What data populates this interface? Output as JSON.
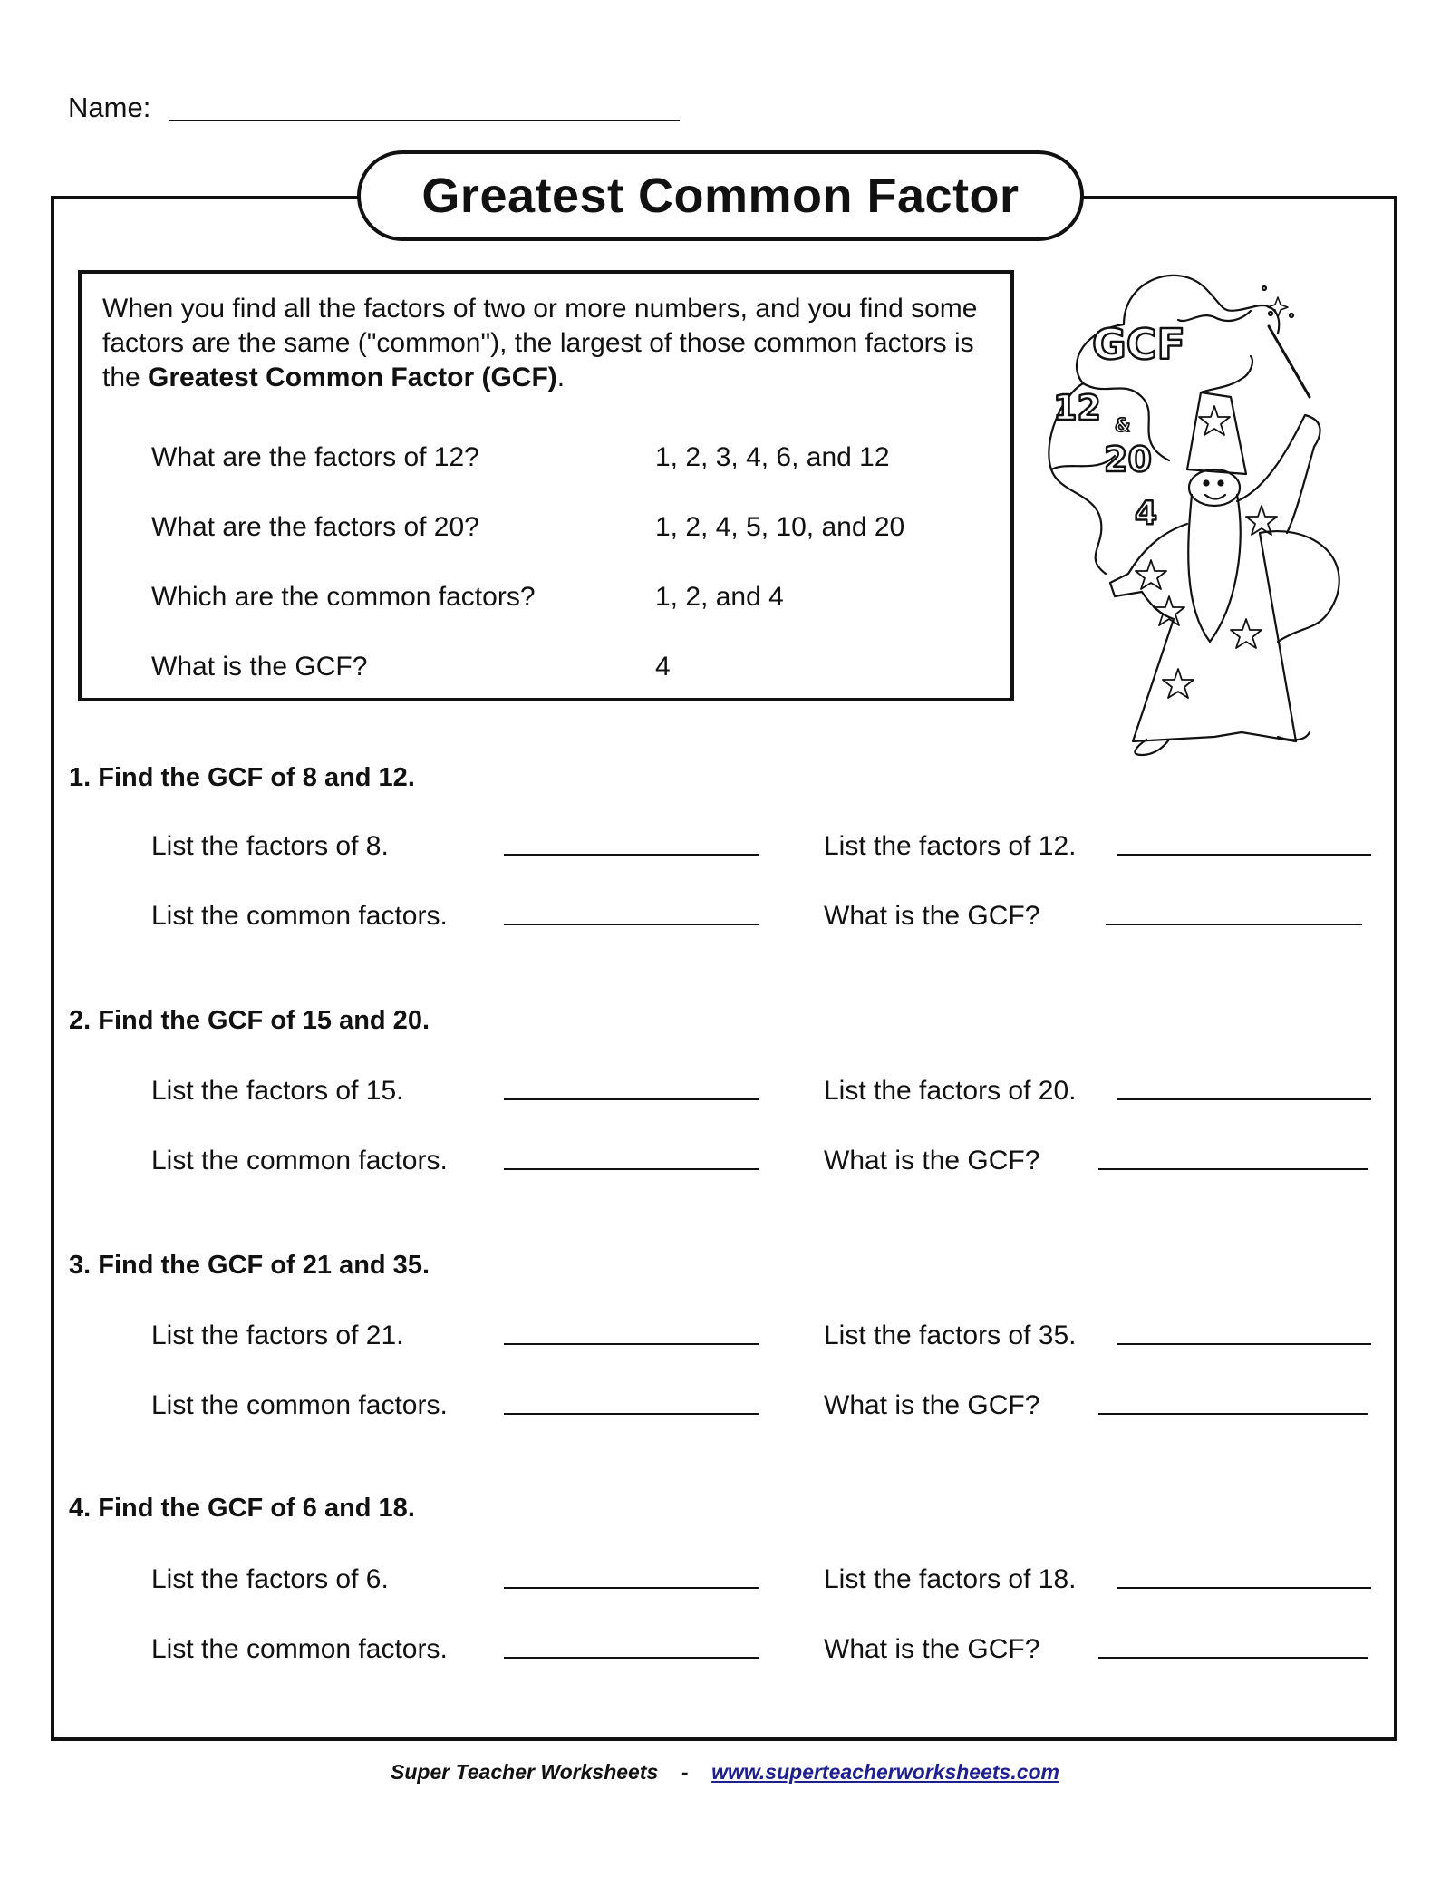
{
  "header": {
    "name_label": "Name:"
  },
  "title": "Greatest Common Factor",
  "intro": {
    "paragraph_plain": "When you find all the factors of two or more numbers, and you find some factors are the same (\"common\"), the largest of those common factors is the ",
    "paragraph_bold": "Greatest Common Factor (GCF)",
    "paragraph_end": ".",
    "example": [
      {
        "question": "What are the factors of 12?",
        "answer": "1, 2, 3, 4, 6, and 12"
      },
      {
        "question": "What are the factors of 20?",
        "answer": "1, 2, 4, 5, 10, and 20"
      },
      {
        "question": "Which are the common factors?",
        "answer": "1, 2, and 4"
      },
      {
        "question": "What is the GCF?",
        "answer": "4"
      }
    ]
  },
  "illustration": {
    "subject": "wizard",
    "labels": [
      "GCF",
      "12",
      "&",
      "20",
      "4"
    ]
  },
  "problems": [
    {
      "heading": "1.  Find the GCF of 8 and 12.",
      "factors_a_label": "List the factors of 8.",
      "factors_b_label": "List the factors of 12.",
      "common_label": "List the common factors.",
      "gcf_label": "What is the GCF?"
    },
    {
      "heading": "2.  Find the GCF of 15 and 20.",
      "factors_a_label": "List the factors of 15.",
      "factors_b_label": "List the factors of 20.",
      "common_label": "List the common factors.",
      "gcf_label": "What is the GCF?"
    },
    {
      "heading": "3.  Find the GCF of 21 and 35.",
      "factors_a_label": "List the factors of 21.",
      "factors_b_label": "List the factors of 35.",
      "common_label": "List the common factors.",
      "gcf_label": "What is the GCF?"
    },
    {
      "heading": "4.  Find the GCF of 6 and 18.",
      "factors_a_label": "List the factors of 6.",
      "factors_b_label": "List the factors of 18.",
      "common_label": "List the common factors.",
      "gcf_label": "What is the GCF?"
    }
  ],
  "footer": {
    "brand": "Super Teacher Worksheets",
    "separator": "-",
    "link_text": "www.superteacherworksheets.com",
    "link_color": "#1f1f8f"
  }
}
